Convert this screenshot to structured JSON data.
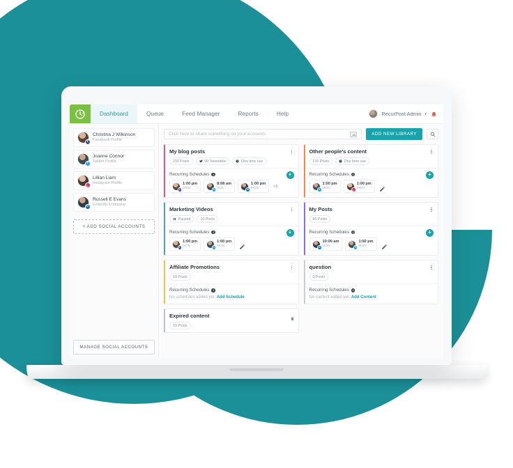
{
  "app": {
    "logo_icon": "recurpost-clock-logo",
    "nav": [
      {
        "label": "Dashboard",
        "active": true
      },
      {
        "label": "Queue",
        "active": false
      },
      {
        "label": "Feed Manager",
        "active": false
      },
      {
        "label": "Reports",
        "active": false
      },
      {
        "label": "Help",
        "active": false
      }
    ],
    "user": {
      "name": "RecurPost Admin",
      "caret": "▾",
      "avatar": "user-avatar",
      "bell": "notification-bell-icon"
    }
  },
  "sidebar": {
    "accounts": [
      {
        "name": "Christina J Wilkinson",
        "type": "Facebook Profile",
        "network": "fb",
        "glyph": "f"
      },
      {
        "name": "Joanne Connor",
        "type": "Twitter Profile",
        "network": "tw",
        "glyph": "t"
      },
      {
        "name": "Lillian Liam",
        "type": "Instagram Profile",
        "network": "ig",
        "glyph": "▢"
      },
      {
        "name": "Russell E Evans",
        "type": "LinkedIn Company",
        "network": "li",
        "glyph": "in"
      }
    ],
    "add_social_label": "+ ADD SOCIAL ACCOUNTS",
    "manage_label": "MANAGE SOCIAL ACCOUNTS"
  },
  "composer": {
    "placeholder": "Click here to share something on your accounts",
    "image_icon": "image-upload-icon",
    "add_library_label": "ADD NEW LIBRARY",
    "search_icon": "search-icon"
  },
  "labels": {
    "recurring_schedules": "Recurring Schedules",
    "info": "i",
    "add_schedule_prefix": "No schedules added yet.",
    "add_schedule_link": "Add Schedule",
    "add_content_prefix": "No content added yet.",
    "add_content_link": "Add Content",
    "plus": "+",
    "edit_icon": "pencil-edit-icon",
    "menu_icon": "kebab-menu-icon",
    "delete_icon": "trash-delete-icon"
  },
  "colors": {
    "teal": "#1b9098",
    "accent": "#18a3ad",
    "logo_green": "#7ac143"
  },
  "cards": [
    {
      "title": "My blog posts",
      "accent": "#e0548a",
      "badges": [
        {
          "text": "210 Posts",
          "icon": ""
        },
        {
          "text": "50 Tweetable",
          "icon": "twitter-bird-icon"
        },
        {
          "text": "One time use",
          "icon": "clock-icon"
        }
      ],
      "schedules": [
        {
          "time": "1:00 pm",
          "day": "MON",
          "network": "fb",
          "glyph": "f"
        },
        {
          "time": "8:08 am",
          "day": "TUE",
          "network": "tw",
          "glyph": "t"
        },
        {
          "time": "1:00 pm",
          "day": "MON",
          "network": "li",
          "glyph": "in"
        }
      ],
      "more": "+5",
      "has_plus": true,
      "has_edit": false,
      "empty": null,
      "menu": "kebab"
    },
    {
      "title": "Other people's content",
      "accent": "#f08a4b",
      "badges": [
        {
          "text": "210 Posts",
          "icon": ""
        },
        {
          "text": "One time use",
          "icon": "clock-icon"
        }
      ],
      "schedules": [
        {
          "time": "1:00 pm",
          "day": "MON",
          "network": "tw",
          "glyph": "t"
        },
        {
          "time": "1:00 pm",
          "day": "MON",
          "network": "ig",
          "glyph": "▢"
        }
      ],
      "more": "",
      "has_plus": true,
      "has_edit": true,
      "empty": null,
      "menu": "kebab"
    },
    {
      "title": "Marketing Videos",
      "accent": "#4a9fd8",
      "badges": [
        {
          "text": "Paused",
          "icon": "pause-icon"
        },
        {
          "text": "10 Posts",
          "icon": ""
        }
      ],
      "schedules": [
        {
          "time": "1:00 pm",
          "day": "MON",
          "network": "fb",
          "glyph": "f"
        },
        {
          "time": "1:00 pm",
          "day": "MON",
          "network": "tw",
          "glyph": "t"
        }
      ],
      "more": "",
      "has_plus": true,
      "has_edit": true,
      "empty": null,
      "menu": "kebab"
    },
    {
      "title": "My Posts",
      "accent": "#8e6fd0",
      "badges": [
        {
          "text": "50 Posts",
          "icon": ""
        }
      ],
      "schedules": [
        {
          "time": "10:00 am",
          "day": "MON",
          "network": "li",
          "glyph": "in"
        },
        {
          "time": "1:00 pm",
          "day": "MON",
          "network": "tw",
          "glyph": "t"
        }
      ],
      "more": "",
      "has_plus": true,
      "has_edit": true,
      "empty": null,
      "menu": "kebab"
    },
    {
      "title": "Affiliate Promotions",
      "accent": "#f2c23e",
      "badges": [
        {
          "text": "10 Posts",
          "icon": ""
        }
      ],
      "schedules": [],
      "more": "",
      "has_plus": false,
      "has_edit": false,
      "empty": "schedule",
      "menu": "kebab"
    },
    {
      "title": "question",
      "accent": "#c4cbd1",
      "badges": [
        {
          "text": "0 Posts",
          "icon": ""
        }
      ],
      "schedules": [],
      "more": "",
      "has_plus": false,
      "has_edit": false,
      "empty": "content",
      "menu": "kebab"
    },
    {
      "title": "Expired content",
      "accent": "#b9c0c6",
      "badges": [
        {
          "text": "10 Posts",
          "icon": ""
        }
      ],
      "schedules": [],
      "more": "",
      "has_plus": false,
      "has_edit": false,
      "empty": null,
      "menu": "trash"
    }
  ]
}
